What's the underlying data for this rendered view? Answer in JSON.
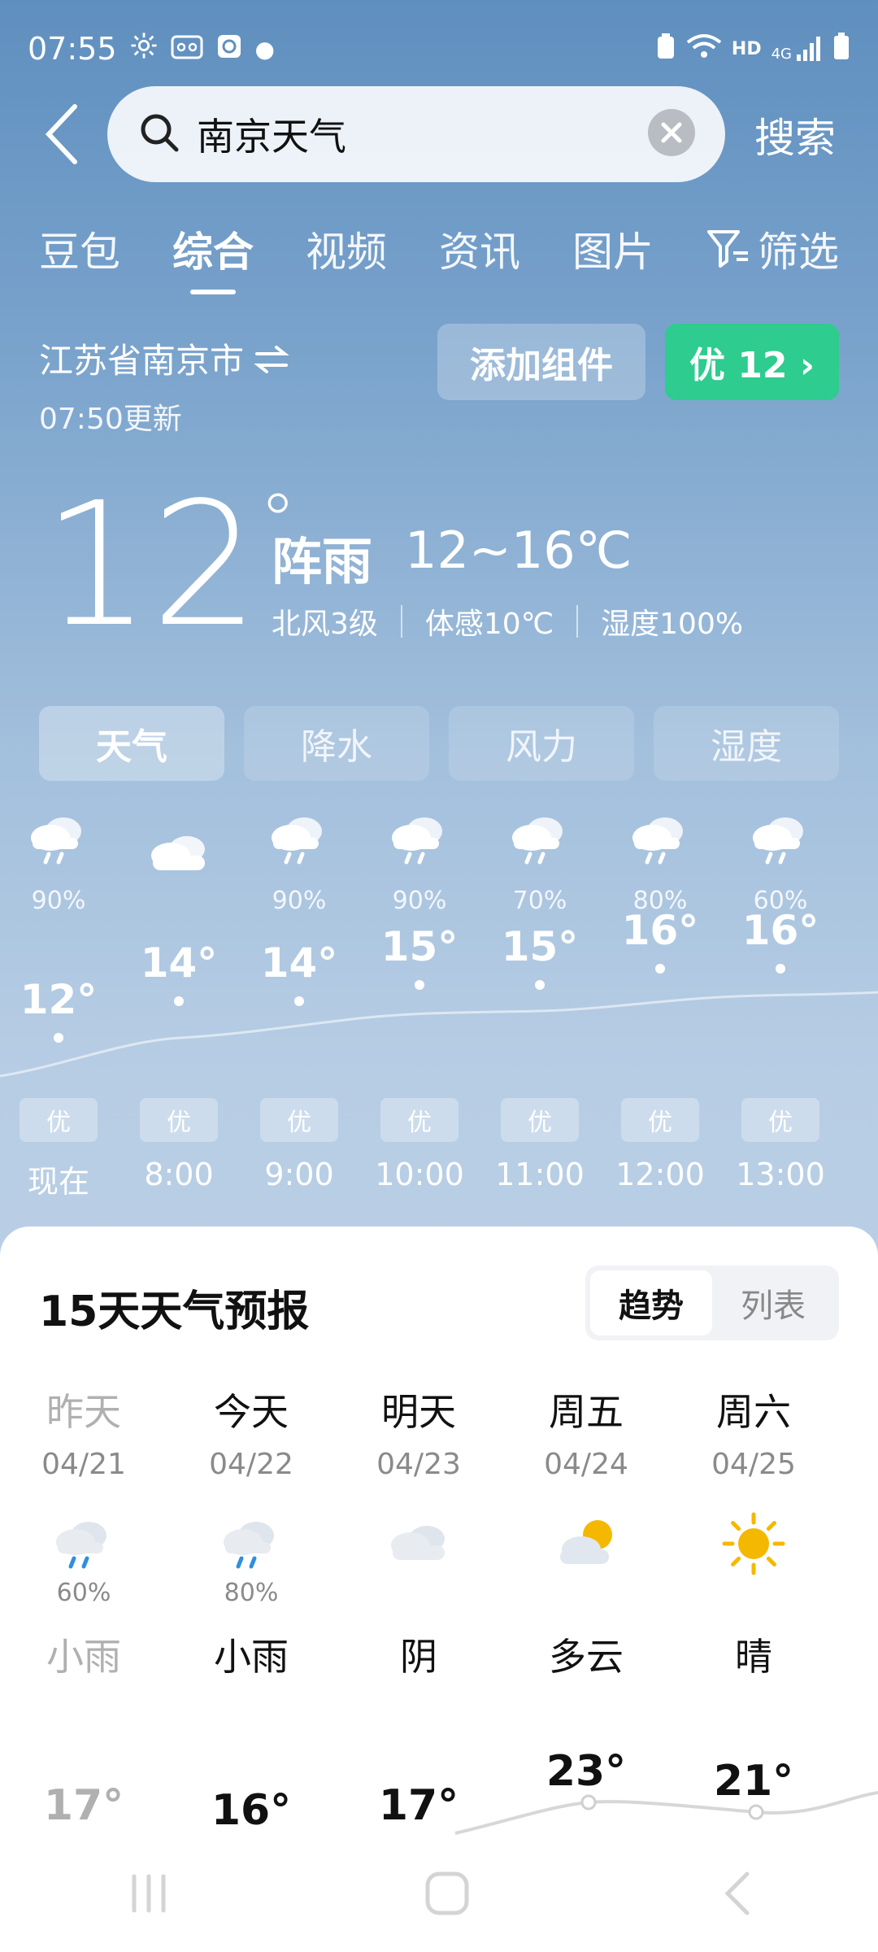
{
  "status_bar": {
    "time": "07:55",
    "network": "HD",
    "network_gen": "4G"
  },
  "search": {
    "query": "南京天气",
    "submit_label": "搜索"
  },
  "tabs": [
    {
      "label": "豆包",
      "active": false
    },
    {
      "label": "综合",
      "active": true
    },
    {
      "label": "视频",
      "active": false
    },
    {
      "label": "资讯",
      "active": false
    },
    {
      "label": "图片",
      "active": false
    }
  ],
  "filter_label": "筛选",
  "location": {
    "name": "江苏省南京市",
    "updated": "07:50更新"
  },
  "add_widget_label": "添加组件",
  "aqi_badge": "优 12 ›",
  "current": {
    "temp": "12",
    "degree": "°",
    "condition": "阵雨",
    "range": "12~16℃",
    "wind": "北风3级",
    "feels_like": "体感10℃",
    "humidity": "湿度100%"
  },
  "segments": [
    "天气",
    "降水",
    "风力",
    "湿度"
  ],
  "hourly": [
    {
      "time": "现在",
      "pct": "90%",
      "temp": "12°",
      "aqi": "优",
      "icon": "rain-cloud-icon"
    },
    {
      "time": "8:00",
      "pct": "",
      "temp": "14°",
      "aqi": "优",
      "icon": "cloud-icon"
    },
    {
      "time": "9:00",
      "pct": "90%",
      "temp": "14°",
      "aqi": "优",
      "icon": "rain-cloud-icon"
    },
    {
      "time": "10:00",
      "pct": "90%",
      "temp": "15°",
      "aqi": "优",
      "icon": "rain-cloud-icon"
    },
    {
      "time": "11:00",
      "pct": "70%",
      "temp": "15°",
      "aqi": "优",
      "icon": "rain-cloud-icon"
    },
    {
      "time": "12:00",
      "pct": "80%",
      "temp": "16°",
      "aqi": "优",
      "icon": "rain-cloud-icon"
    },
    {
      "time": "13:00",
      "pct": "60%",
      "temp": "16°",
      "aqi": "优",
      "icon": "rain-cloud-icon"
    }
  ],
  "forecast": {
    "title": "15天天气预报",
    "view_options": [
      "趋势",
      "列表"
    ],
    "days": [
      {
        "name": "昨天",
        "date": "04/21",
        "pp": "60%",
        "desc": "小雨",
        "hi": "17°",
        "icon": "rain-cloud-icon"
      },
      {
        "name": "今天",
        "date": "04/22",
        "pp": "80%",
        "desc": "小雨",
        "hi": "16°",
        "icon": "rain-cloud-icon"
      },
      {
        "name": "明天",
        "date": "04/23",
        "pp": "",
        "desc": "阴",
        "hi": "17°",
        "icon": "cloud-icon"
      },
      {
        "name": "周五",
        "date": "04/24",
        "pp": "",
        "desc": "多云",
        "hi": "23°",
        "icon": "partly-cloudy-icon"
      },
      {
        "name": "周六",
        "date": "04/25",
        "pp": "",
        "desc": "晴",
        "hi": "21°",
        "icon": "sun-icon"
      }
    ]
  },
  "colors": {
    "aqi_green": "#2ecc8e",
    "rain_blue": "#2e8fe0",
    "sun_yellow": "#f5b800"
  }
}
